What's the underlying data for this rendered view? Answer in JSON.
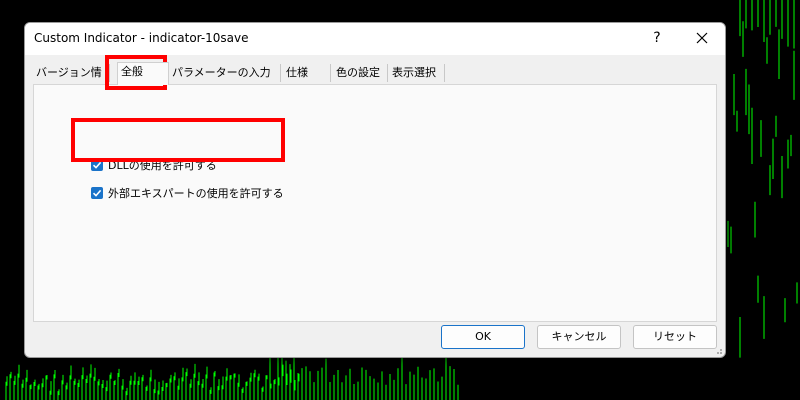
{
  "window": {
    "title": "Custom Indicator - indicator-10save",
    "help_label": "?"
  },
  "tabs": [
    {
      "label": "バージョン情報",
      "active": false
    },
    {
      "label": "全般",
      "active": true
    },
    {
      "label": "パラメーターの入力",
      "active": false
    },
    {
      "label": "仕様",
      "active": false
    },
    {
      "label": "色の設定",
      "active": false
    },
    {
      "label": "表示選択",
      "active": false
    }
  ],
  "general": {
    "allow_dll": {
      "label": "DLLの使用を許可する",
      "checked": true
    },
    "allow_experts": {
      "label": "外部エキスパートの使用を許可する",
      "checked": true
    }
  },
  "buttons": {
    "ok": "OK",
    "cancel": "キャンセル",
    "reset": "リセット"
  },
  "colors": {
    "checkbox": "#1a73c9",
    "highlight": "#ff0000",
    "chart_candles": "#00ff00",
    "chart_background": "#000000"
  }
}
